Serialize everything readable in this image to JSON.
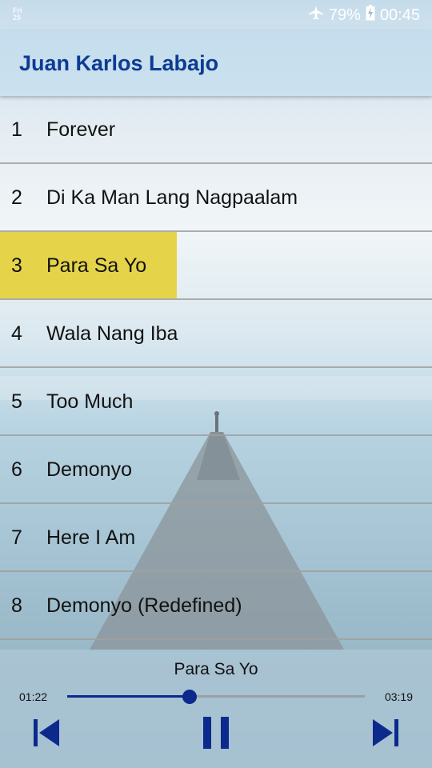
{
  "status": {
    "day": "Fri",
    "date": "25",
    "battery": "79%",
    "time": "00:45",
    "icons": [
      "airplane-icon",
      "battery-charging-icon"
    ]
  },
  "app": {
    "title": "Juan Karlos Labajo"
  },
  "songs": [
    {
      "num": "1",
      "title": "Forever"
    },
    {
      "num": "2",
      "title": "Di Ka Man Lang Nagpaalam"
    },
    {
      "num": "3",
      "title": "Para Sa Yo"
    },
    {
      "num": "4",
      "title": "Wala Nang Iba"
    },
    {
      "num": "5",
      "title": "Too Much"
    },
    {
      "num": "6",
      "title": "Demonyo"
    },
    {
      "num": "7",
      "title": "Here I Am"
    },
    {
      "num": "8",
      "title": "Demonyo (Redefined)"
    }
  ],
  "selected_index": 2,
  "player": {
    "now_playing": "Para Sa Yo",
    "current_time": "01:22",
    "total_time": "03:19",
    "progress": 0.411,
    "controls": [
      "skip-previous-icon",
      "pause-icon",
      "skip-next-icon"
    ]
  },
  "colors": {
    "title": "#0d3b93",
    "highlight": "#e5d44a",
    "accent": "#0b2a8c"
  }
}
